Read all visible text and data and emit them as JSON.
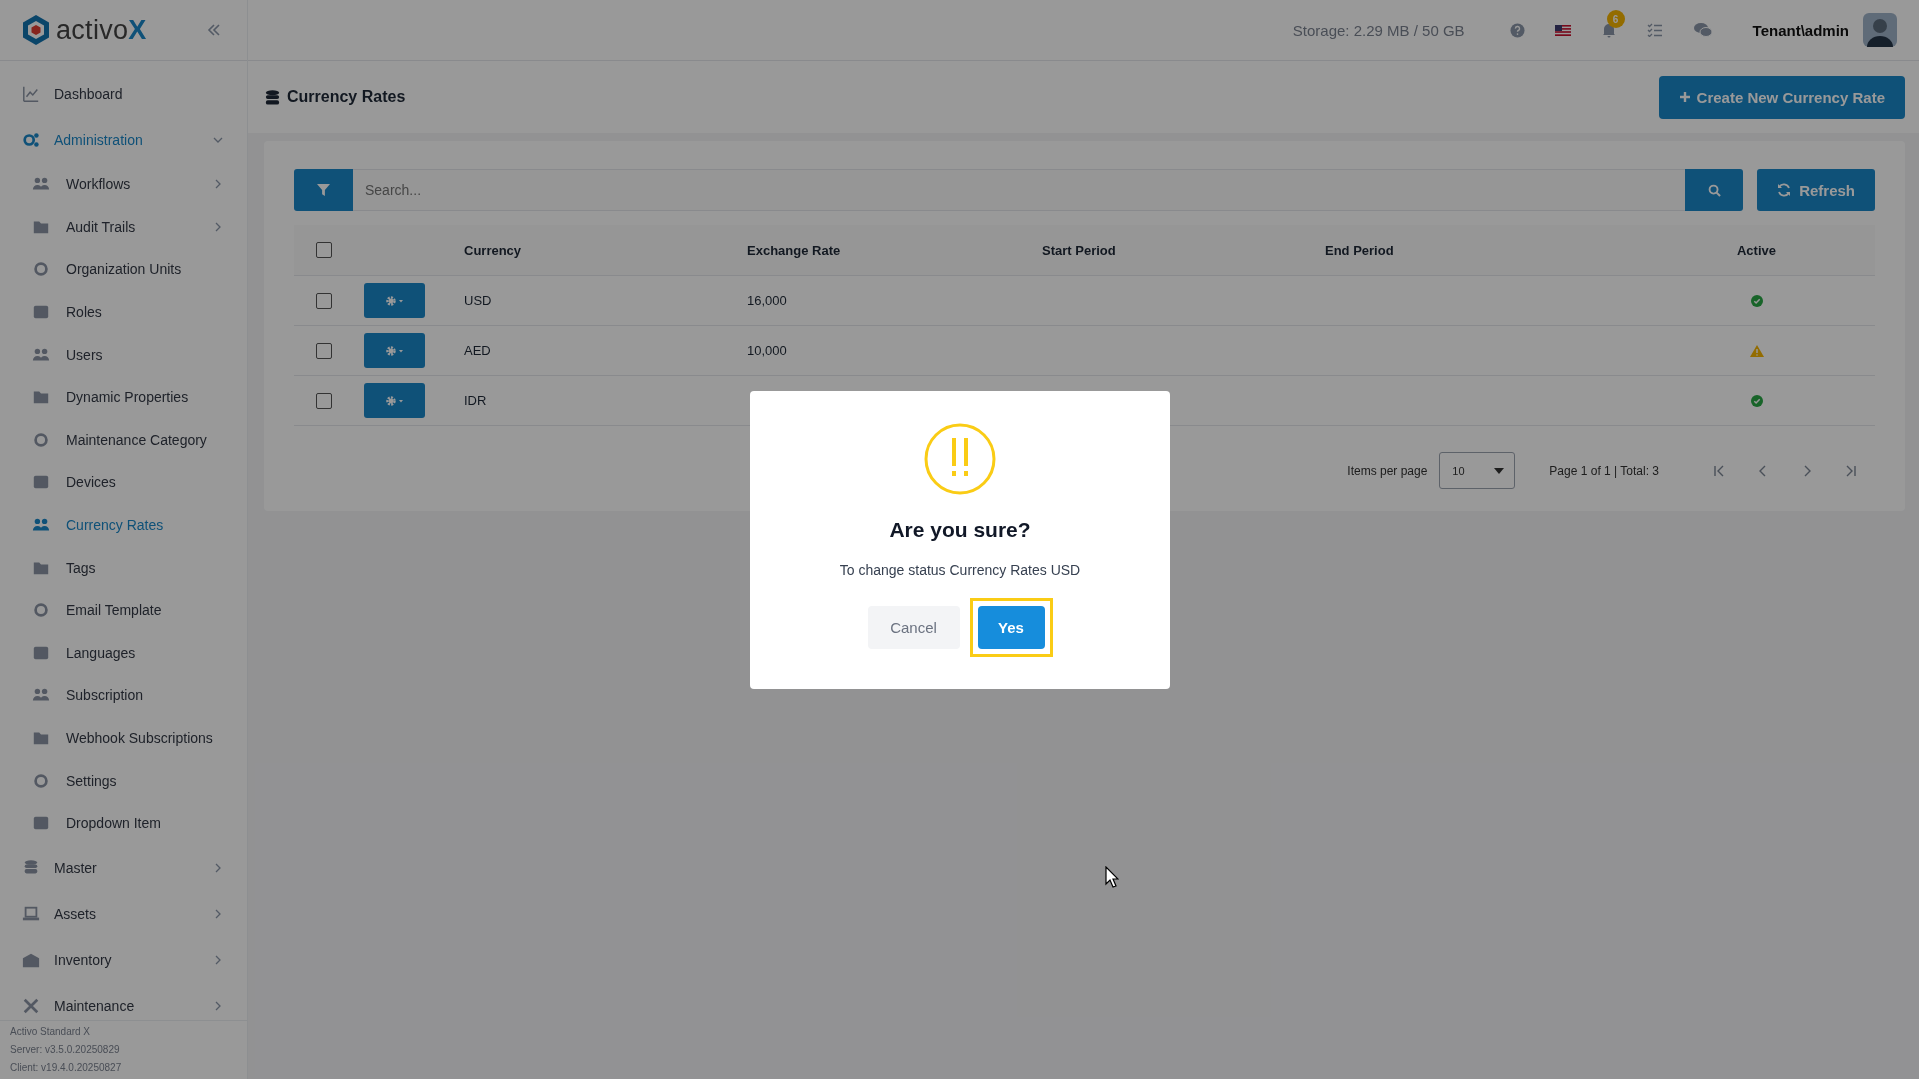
{
  "app": {
    "logo_text": "activo",
    "logo_mark": "X"
  },
  "topbar": {
    "storage": "Storage: 2.29 MB / 50 GB",
    "notification_count": "6",
    "user": "Tenant\\admin"
  },
  "sidebar": {
    "items": [
      {
        "label": "Dashboard",
        "selected": false
      },
      {
        "label": "Administration",
        "selected": true,
        "expanded": true,
        "children": [
          {
            "label": "Workflows",
            "selected": false,
            "expanded": false
          },
          {
            "label": "Audit Trails",
            "selected": false,
            "expanded": false
          },
          {
            "label": "Organization Units",
            "selected": false
          },
          {
            "label": "Roles",
            "selected": false
          },
          {
            "label": "Users",
            "selected": false
          },
          {
            "label": "Dynamic Properties",
            "selected": false
          },
          {
            "label": "Maintenance Category",
            "selected": false
          },
          {
            "label": "Devices",
            "selected": false
          },
          {
            "label": "Currency Rates",
            "selected": true
          },
          {
            "label": "Tags",
            "selected": false
          },
          {
            "label": "Email Template",
            "selected": false
          },
          {
            "label": "Languages",
            "selected": false
          },
          {
            "label": "Subscription",
            "selected": false
          },
          {
            "label": "Webhook Subscriptions",
            "selected": false
          },
          {
            "label": "Settings",
            "selected": false
          },
          {
            "label": "Dropdown Item",
            "selected": false
          }
        ]
      },
      {
        "label": "Master",
        "selected": false,
        "expanded": false
      },
      {
        "label": "Assets",
        "selected": false,
        "expanded": false
      },
      {
        "label": "Inventory",
        "selected": false,
        "expanded": false
      },
      {
        "label": "Maintenance",
        "selected": false,
        "expanded": false
      }
    ],
    "footer": [
      "Activo Standard X",
      "Server: v3.5.0.20250829",
      "Client: v19.4.0.20250827"
    ]
  },
  "page": {
    "title": "Currency Rates",
    "create_button": "Create New Currency Rate"
  },
  "toolbar": {
    "search_placeholder": "Search...",
    "refresh_button": "Refresh"
  },
  "table": {
    "all_checked": false,
    "columns": [
      "Currency",
      "Exchange Rate",
      "Start Period",
      "End Period",
      "Active"
    ],
    "rows": [
      {
        "checked": false,
        "currency": "USD",
        "exchange_rate": "16,000",
        "active": true
      },
      {
        "checked": false,
        "currency": "AED",
        "exchange_rate": "10,000",
        "active": false
      },
      {
        "checked": false,
        "currency": "IDR",
        "active": true
      }
    ]
  },
  "pagination": {
    "items_per_page_label": "Items per page",
    "page_size": "10",
    "summary": "Page 1 of 1 | Total: 3"
  },
  "dialog": {
    "title": "Are you sure?",
    "message": "To change status Currency Rates USD",
    "cancel_button": "Cancel",
    "confirm_button": "Yes",
    "confirm_highlighted": true
  }
}
